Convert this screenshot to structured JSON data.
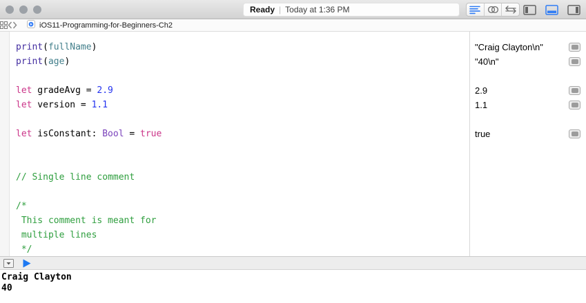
{
  "toolbar": {
    "status": {
      "state": "Ready",
      "separator": "|",
      "detail": "Today at 1:36 PM"
    },
    "accent_color": "#2f7cf5",
    "icon_gray": "#6b6b6b",
    "icons": {
      "standard_editor": "lines-icon",
      "assistant_editor": "linked-circles-icon",
      "version_editor": "swap-arrows-icon",
      "navigator_panel": "panel-left-icon",
      "debug_panel": "panel-bottom-icon",
      "inspector_panel": "panel-right-icon"
    }
  },
  "jumpbar": {
    "title": "iOS11-Programming-for-Beginners-Ch2",
    "icons": {
      "related_items": "grid-icon",
      "back": "chevron-left",
      "forward": "chevron-right",
      "file": "playground-file-icon"
    }
  },
  "editor": {
    "colors": {
      "plain": "#000000",
      "function": "#432da0",
      "member": "#44808c",
      "keyword": "#cb3589",
      "number": "#2433ef",
      "type": "#7a42bb",
      "comment": "#2e9e3e"
    },
    "lines": [
      [
        {
          "t": "print",
          "c": "function"
        },
        {
          "t": "(",
          "c": "plain"
        },
        {
          "t": "fullName",
          "c": "member"
        },
        {
          "t": ")",
          "c": "plain"
        }
      ],
      [
        {
          "t": "print",
          "c": "function"
        },
        {
          "t": "(",
          "c": "plain"
        },
        {
          "t": "age",
          "c": "member"
        },
        {
          "t": ")",
          "c": "plain"
        }
      ],
      [],
      [
        {
          "t": "let",
          "c": "keyword"
        },
        {
          "t": " gradeAvg = ",
          "c": "plain"
        },
        {
          "t": "2.9",
          "c": "number"
        }
      ],
      [
        {
          "t": "let",
          "c": "keyword"
        },
        {
          "t": " version = ",
          "c": "plain"
        },
        {
          "t": "1.1",
          "c": "number"
        }
      ],
      [],
      [
        {
          "t": "let",
          "c": "keyword"
        },
        {
          "t": " isConstant: ",
          "c": "plain"
        },
        {
          "t": "Bool",
          "c": "type"
        },
        {
          "t": " = ",
          "c": "plain"
        },
        {
          "t": "true",
          "c": "keyword"
        }
      ],
      [],
      [],
      [
        {
          "t": "// Single line comment",
          "c": "comment"
        }
      ],
      [],
      [
        {
          "t": "/*",
          "c": "comment"
        }
      ],
      [
        {
          "t": " This comment is meant for",
          "c": "comment"
        }
      ],
      [
        {
          "t": " multiple lines",
          "c": "comment"
        }
      ],
      [
        {
          "t": " */",
          "c": "comment"
        }
      ]
    ]
  },
  "results": {
    "rows": [
      {
        "line": 0,
        "value": "\"Craig Clayton\\n\""
      },
      {
        "line": 1,
        "value": "\"40\\n\""
      },
      {
        "line": 3,
        "value": "2.9"
      },
      {
        "line": 4,
        "value": "1.1"
      },
      {
        "line": 6,
        "value": "true"
      }
    ]
  },
  "debug": {
    "icons": {
      "toggle_console": "collapse-down-icon",
      "run": "play-icon"
    },
    "console_lines": [
      "Craig Clayton",
      "40"
    ]
  }
}
